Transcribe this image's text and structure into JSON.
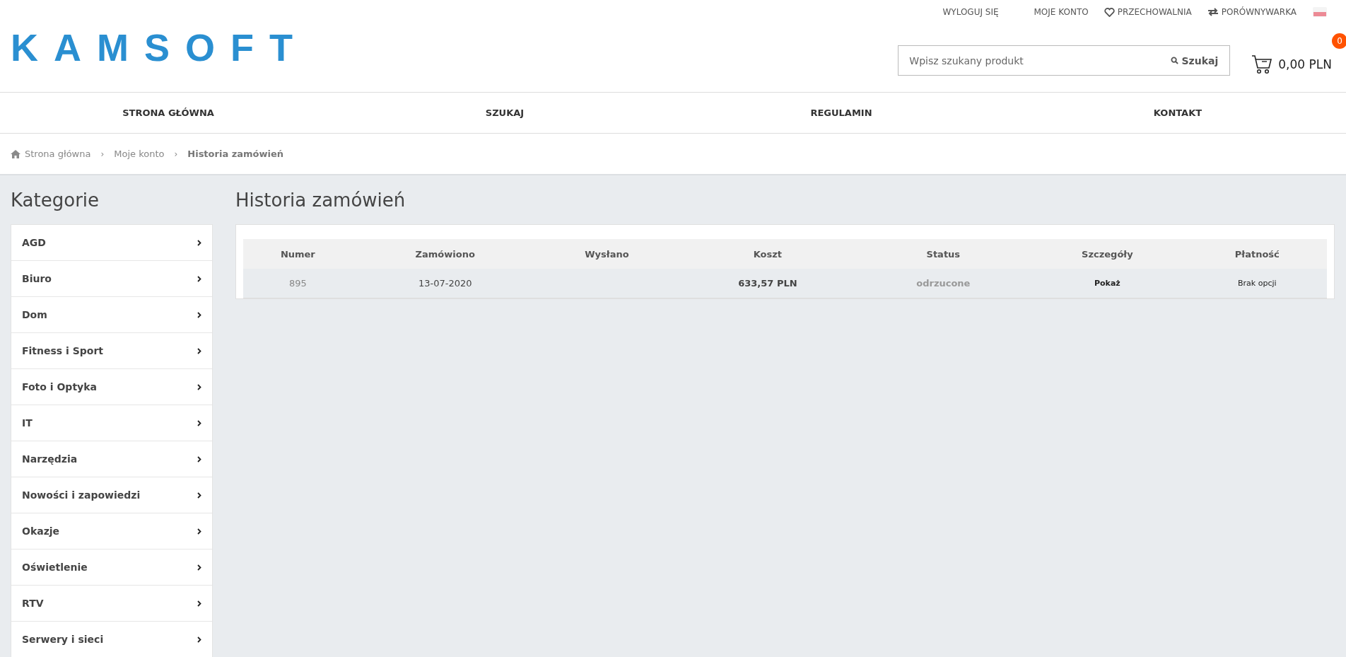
{
  "top_links": [
    {
      "kind": "text",
      "label": "WYLOGUJ SIĘ"
    },
    {
      "kind": "text",
      "label": "MOJE KONTO"
    },
    {
      "kind": "heart",
      "label": "PRZECHOWALNIA"
    },
    {
      "kind": "swap",
      "label": "PORÓWNYWARKA"
    },
    {
      "kind": "flag"
    }
  ],
  "logo": "KAMSOFT",
  "search": {
    "placeholder": "Wpisz szukany produkt",
    "button": "Szukaj"
  },
  "cart": {
    "count": "0",
    "total": "0,00 PLN"
  },
  "nav": [
    "STRONA GŁÓWNA",
    "SZUKAJ",
    "REGULAMIN",
    "KONTAKT"
  ],
  "breadcrumb": [
    {
      "label": "Strona główna",
      "current": false
    },
    {
      "separator": "›",
      "label": "Moje konto",
      "current": false
    },
    {
      "separator": "›",
      "label": "Historia zamówień",
      "current": true
    }
  ],
  "sidebar": {
    "title": "Kategorie",
    "items": [
      "AGD",
      "Biuro",
      "Dom",
      "Fitness i Sport",
      "Foto i Optyka",
      "IT",
      "Narzędzia",
      "Nowości i zapowiedzi",
      "Okazje",
      "Oświetlenie",
      "RTV",
      "Serwery i sieci"
    ]
  },
  "page_title": "Historia zamówień",
  "table": {
    "columns": [
      "Numer",
      "Zamówiono",
      "Wysłano",
      "Koszt",
      "Status",
      "Szczegóły",
      "Płatność"
    ],
    "rows": [
      {
        "number": "895",
        "ordered": "13-07-2020",
        "cost": "633,57 PLN",
        "status": "odrzucone",
        "details": "Pokaż",
        "payment": "Brak opcji"
      }
    ]
  }
}
